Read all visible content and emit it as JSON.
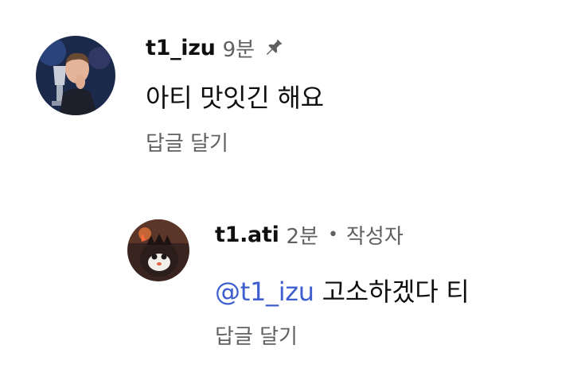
{
  "comments": [
    {
      "author": "t1_izu",
      "time": "9분",
      "pinned_icon": "pin-icon",
      "text": "아티 맛잇긴 해요",
      "reply_label": "답글 달기"
    },
    {
      "author": "t1.ati",
      "time": "2분",
      "separator": "•",
      "owner_label": "작성자",
      "mention": "@t1_izu",
      "text": " 고소하겠다 티",
      "reply_label": "답글 달기"
    }
  ],
  "colors": {
    "text": "#0f0f0f",
    "secondary": "#606060",
    "mention": "#3e5dcf"
  }
}
